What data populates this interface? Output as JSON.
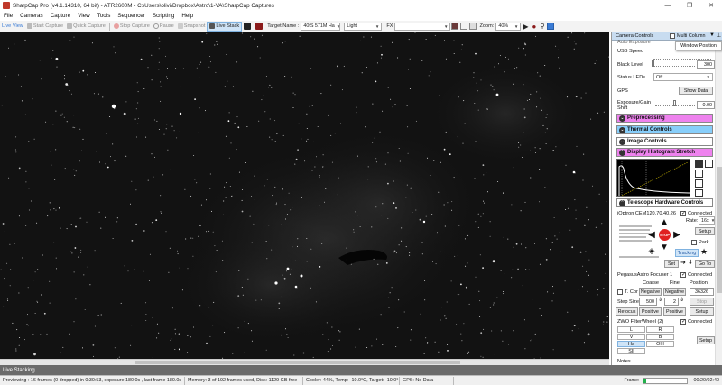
{
  "window": {
    "title": "SharpCap Pro (v4.1.14310, 64 bit) - ATR2600M - C:\\Users\\olivi\\Dropbox\\Astro\\1-VA\\SharpCap Captures",
    "controls": {
      "minimize": "—",
      "restore": "❐",
      "close": "✕"
    }
  },
  "menu": [
    "File",
    "Cameras",
    "Capture",
    "View",
    "Tools",
    "Sequencer",
    "Scripting",
    "Help"
  ],
  "toolbar": {
    "live_view": "Live View",
    "start_capture": "Start Capture",
    "quick_capture": "Quick Capture",
    "stop_capture": "Stop Capture",
    "pause": "Pause",
    "snapshot": "Snapshot",
    "live_stack": "Live Stack",
    "target_name_label": "Target Name :",
    "target_name_value": "40fS 571M Ha",
    "profile_value": "Light",
    "fx_label": "FX",
    "fx_value": "",
    "zoom_label": "Zoom:",
    "zoom_value": "40%"
  },
  "panel": {
    "camera_controls_title": "Camera Controls",
    "multi_column": "Multi Column",
    "window_position_tooltip": "Window Position",
    "auto_exposure_label": "Auto Exposure",
    "usb_speed_label": "USB Speed",
    "black_level_label": "Black Level",
    "black_level_value": "300",
    "black_level_fraction": 0.0,
    "status_leds_label": "Status LEDs",
    "status_leds_value": "Off",
    "gps_label": "GPS",
    "show_data": "Show Data",
    "exposure_gain_shift_label": "Exposure/Gain Shift",
    "exposure_gain_shift_value": "0.00",
    "sections": {
      "preprocessing": "Preprocessing",
      "thermal": "Thermal Controls",
      "image": "Image Controls",
      "histogram": "Display Histogram Stretch",
      "telescope": "Telescope Hardware Controls"
    },
    "section_colors": {
      "preprocessing": "#ee82ee",
      "thermal": "#87cefa",
      "image": "#ffffff",
      "histogram": "#ee82ee",
      "telescope": "#ffffff"
    },
    "mount": {
      "name": "iOptron CEM120,70,40,26",
      "connected": "Connected",
      "rate_label": "Rate:",
      "rate_value": "16x",
      "setup": "Setup",
      "stop": "STOP",
      "park": "Park",
      "tracking": "Tracking",
      "set": "Set",
      "goto": "Go To"
    },
    "focuser": {
      "name": "PegasusAstro Focuser 1",
      "connected": "Connected",
      "col_coarse": "Coarse",
      "col_fine": "Fine",
      "col_position": "Position",
      "t_comp": "T. Cor",
      "negative_coarse": "Negative",
      "negative_fine": "Negative",
      "position_value": "36326",
      "step_size_label": "Step Size",
      "step_size_value": "500",
      "fine_step_value": "2",
      "stop": "Stop",
      "refocus": "Refocus",
      "positive_coarse": "Positive",
      "positive_fine": "Positive",
      "setup": "Setup"
    },
    "filter_wheel": {
      "name": "ZWO FilterWheel (2)",
      "connected": "Connected",
      "filters": [
        "L",
        "R",
        "V",
        "B",
        "Ha",
        "OIII",
        "SII"
      ],
      "setup": "Setup"
    },
    "notes_label": "Notes"
  },
  "live_stacking_label": "Live Stacking",
  "status": {
    "previewing": "Previewing : 16 frames (0 dropped) in 0:30:53, exposure 180.0s , last frame 180.0s",
    "memory": "Memory: 3 of 192 frames used, Disk: 1129 GB free",
    "cooler": "Cooler: 44%, Temp: -10.0°C, Target: -10.0°",
    "gps": "GPS: No Data",
    "frame_label": "Frame:",
    "frame_progress": 0.07,
    "time": "00:20/02:40"
  },
  "colors": {
    "image_background": "#121212",
    "accent_pressed": "#cfe4f7",
    "stop_red": "#e02020",
    "progress_green": "#22b14c"
  }
}
